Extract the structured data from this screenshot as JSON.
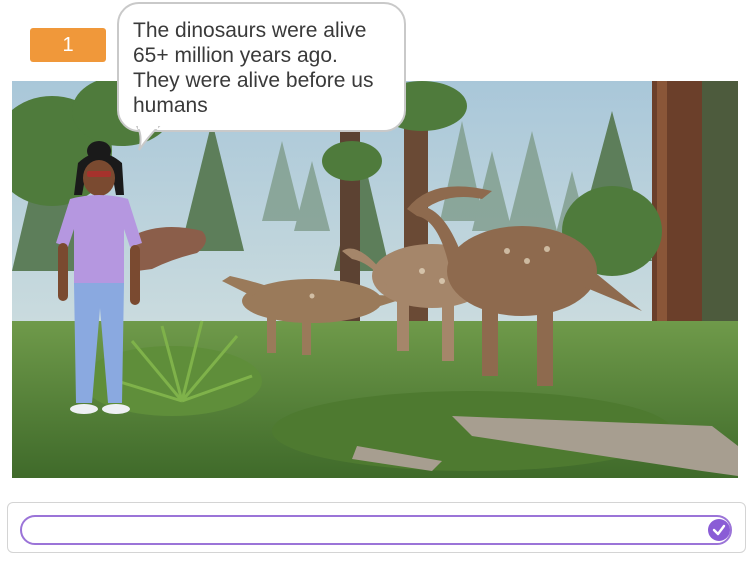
{
  "variable_monitor": {
    "value": "1"
  },
  "speech_bubble": {
    "text": "The dinosaurs were alive\n65+ million years ago.\nThey were alive before us\nhumans"
  },
  "ask_box": {
    "value": "",
    "placeholder": ""
  },
  "icons": {
    "submit": "check-icon"
  },
  "colors": {
    "monitor": "#f0983a",
    "input_border": "#9b74d8",
    "submit": "#8a5cd6"
  }
}
